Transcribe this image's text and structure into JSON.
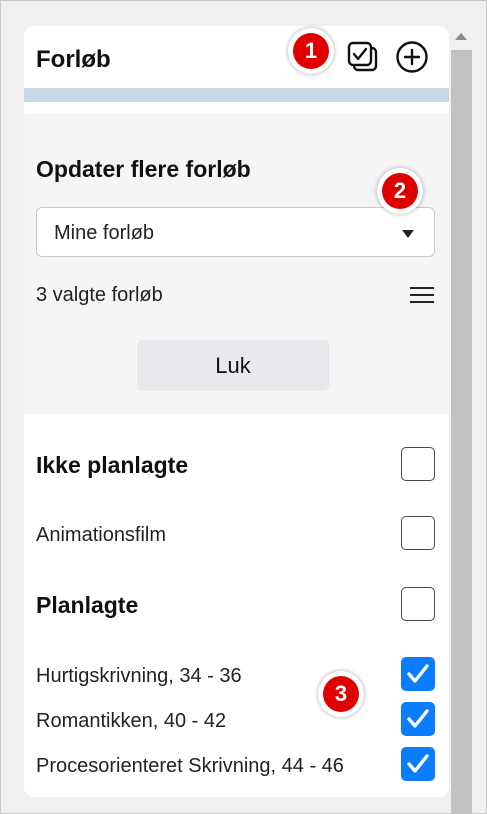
{
  "header": {
    "title": "Forløb"
  },
  "update_section": {
    "title": "Opdater flere forløb",
    "dropdown_value": "Mine forløb",
    "selected_count_text": "3 valgte forløb",
    "close_label": "Luk"
  },
  "groups": {
    "unplanned": {
      "title": "Ikke planlagte",
      "items": [
        {
          "label": "Animationsfilm",
          "checked": false
        }
      ]
    },
    "planned": {
      "title": "Planlagte",
      "items": [
        {
          "label": "Hurtigskrivning, 34 - 36",
          "checked": true
        },
        {
          "label": "Romantikken, 40 - 42",
          "checked": true
        },
        {
          "label": "Procesorienteret Skrivning, 44 - 46",
          "checked": true
        }
      ]
    }
  },
  "badges": [
    "1",
    "2",
    "3"
  ],
  "colors": {
    "accent": "#0a7cff",
    "strip": "#c9d8e6",
    "badge": "#e00000"
  }
}
